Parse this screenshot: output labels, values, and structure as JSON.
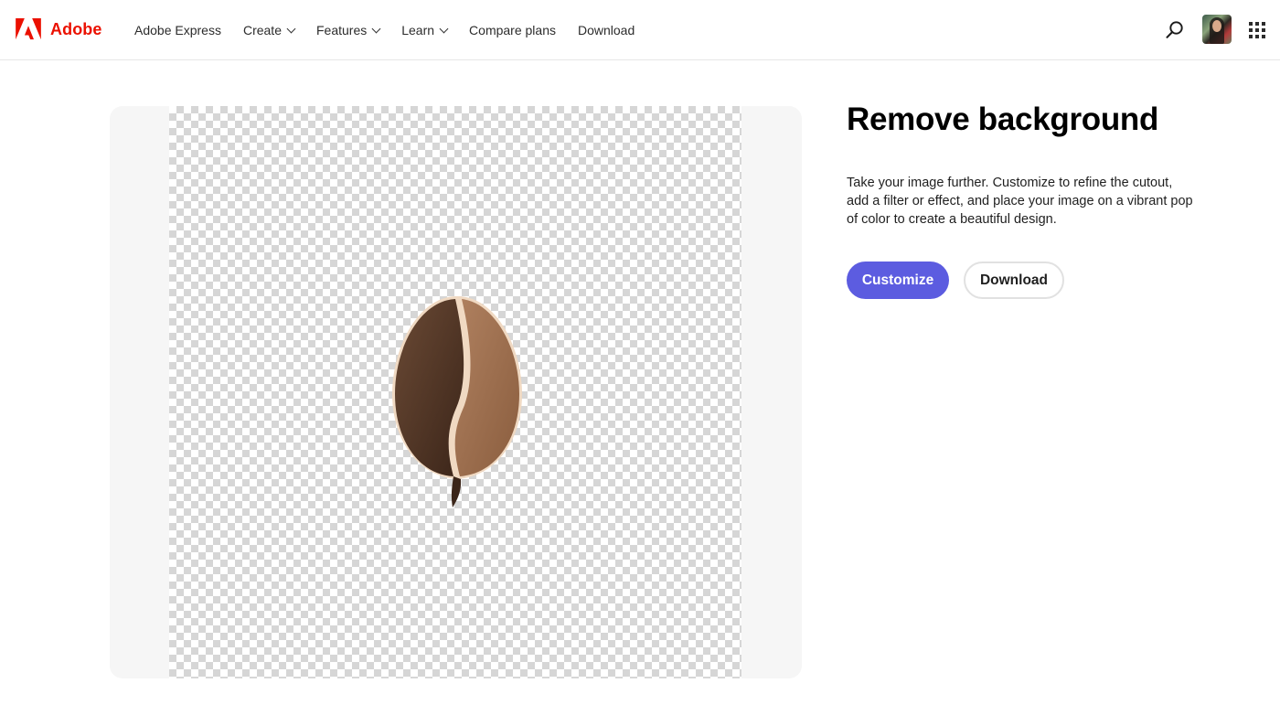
{
  "header": {
    "brand": "Adobe",
    "brand_color": "#eb1000",
    "logo_icon": "adobe-logo-icon",
    "nav": [
      {
        "label": "Adobe Express",
        "dropdown": false
      },
      {
        "label": "Create",
        "dropdown": true
      },
      {
        "label": "Features",
        "dropdown": true
      },
      {
        "label": "Learn",
        "dropdown": true
      },
      {
        "label": "Compare plans",
        "dropdown": false
      },
      {
        "label": "Download",
        "dropdown": false
      }
    ],
    "search_icon": "search-icon",
    "avatar_icon": "user-avatar",
    "apps_icon": "app-switcher-grid-icon"
  },
  "preview": {
    "background": "transparent-checkerboard",
    "subject": "coffee-bean-icon"
  },
  "panel": {
    "title": "Remove background",
    "description": "Take your image further. Customize to refine the cutout, add a filter or effect, and place your image on a vibrant pop of color to create a beautiful design.",
    "primary_button": "Customize",
    "secondary_button": "Download",
    "accent_color": "#5c5ce0"
  }
}
